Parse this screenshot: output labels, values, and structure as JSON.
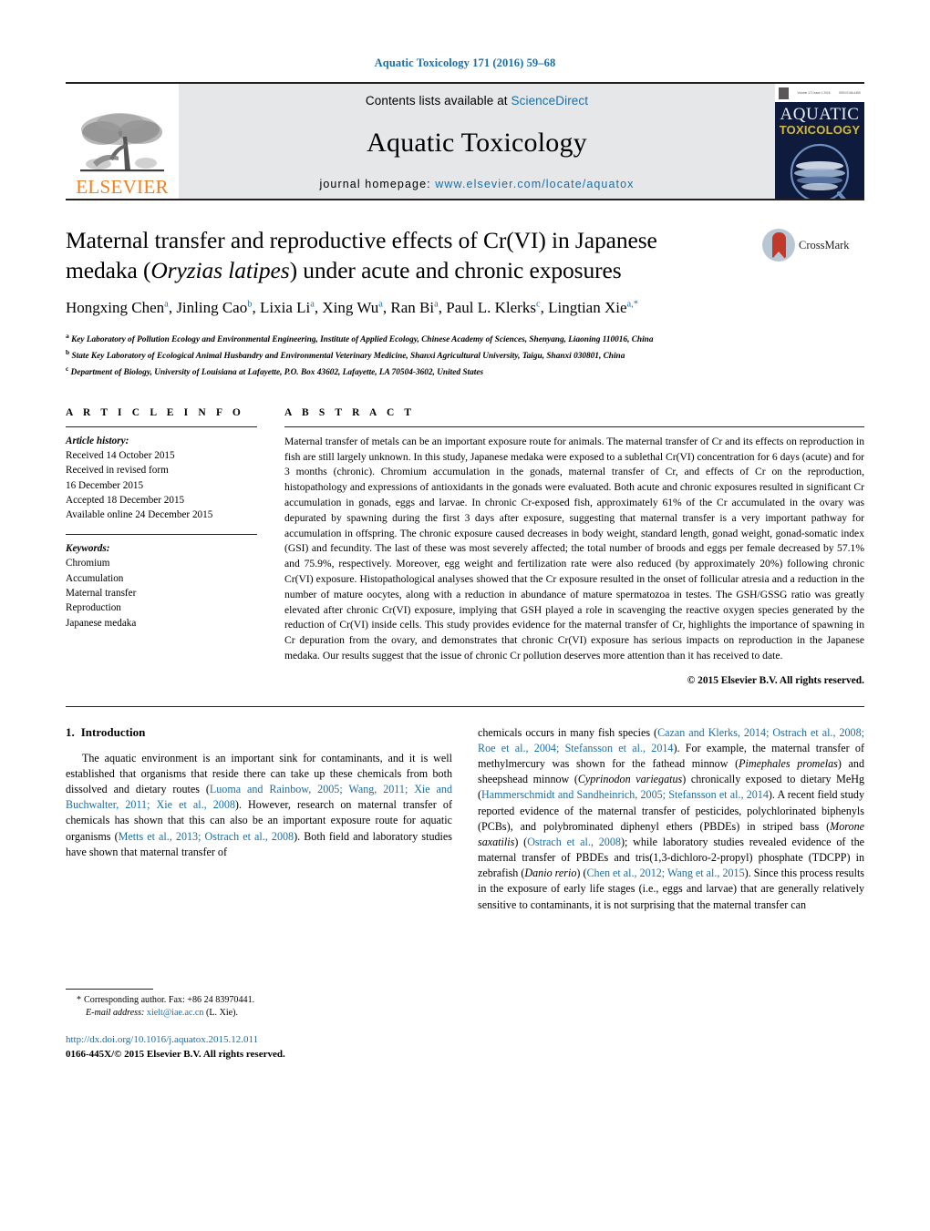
{
  "running_head": "Aquatic Toxicology 171 (2016) 59–68",
  "masthead": {
    "publisher_name": "ELSEVIER",
    "contents_prefix": "Contents lists available at ",
    "contents_link": "ScienceDirect",
    "journal_title": "Aquatic Toxicology",
    "homepage_prefix": "journal homepage: ",
    "homepage_url": "www.elsevier.com/locate/aquatox",
    "cover": {
      "line1": "AQUATIC",
      "line2": "TOXICOLOGY",
      "masthead_tiny_left": "Volume 171 Issue 1 2016",
      "masthead_tiny_right": "ISSN 0166-445X"
    }
  },
  "article": {
    "title_line1": "Maternal transfer and reproductive effects of Cr(VI) in Japanese",
    "title_line2_pre": "medaka (",
    "title_line2_italic": "Oryzias latipes",
    "title_line2_post": ") under acute and chronic exposures",
    "crossmark_label": "CrossMark",
    "authors": [
      {
        "name": "Hongxing Chen",
        "sup": "a",
        "sep": ", "
      },
      {
        "name": "Jinling Cao",
        "sup": "b",
        "sep": ", "
      },
      {
        "name": "Lixia Li",
        "sup": "a",
        "sep": ", "
      },
      {
        "name": "Xing Wu",
        "sup": "a",
        "sep": ", "
      },
      {
        "name": "Ran Bi",
        "sup": "a",
        "sep": ", "
      },
      {
        "name": "Paul L. Klerks",
        "sup": "c",
        "sep": ", "
      },
      {
        "name": "Lingtian Xie",
        "sup": "a,*",
        "sep": ""
      }
    ],
    "affiliations": [
      {
        "marker": "a",
        "text": "Key Laboratory of Pollution Ecology and Environmental Engineering, Institute of Applied Ecology, Chinese Academy of Sciences, Shenyang, Liaoning 110016, China"
      },
      {
        "marker": "b",
        "text": "State Key Laboratory of Ecological Animal Husbandry and Environmental Veterinary Medicine, Shanxi Agricultural University, Taigu, Shanxi 030801, China"
      },
      {
        "marker": "c",
        "text": "Department of Biology, University of Louisiana at Lafayette, P.O. Box 43602, Lafayette, LA 70504-3602, United States"
      }
    ]
  },
  "article_info": {
    "heading": "A R T I C L E   I N F O",
    "history_label": "Article history:",
    "history": [
      "Received 14 October 2015",
      "Received in revised form",
      "16 December 2015",
      "Accepted 18 December 2015",
      "Available online 24 December 2015"
    ],
    "keywords_label": "Keywords:",
    "keywords": [
      "Chromium",
      "Accumulation",
      "Maternal transfer",
      "Reproduction",
      "Japanese medaka"
    ]
  },
  "abstract": {
    "heading": "A B S T R A C T",
    "text": "Maternal transfer of metals can be an important exposure route for animals. The maternal transfer of Cr and its effects on reproduction in fish are still largely unknown. In this study, Japanese medaka were exposed to a sublethal Cr(VI) concentration for 6 days (acute) and for 3 months (chronic). Chromium accumulation in the gonads, maternal transfer of Cr, and effects of Cr on the reproduction, histopathology and expressions of antioxidants in the gonads were evaluated. Both acute and chronic exposures resulted in significant Cr accumulation in gonads, eggs and larvae. In chronic Cr-exposed fish, approximately 61% of the Cr accumulated in the ovary was depurated by spawning during the first 3 days after exposure, suggesting that maternal transfer is a very important pathway for accumulation in offspring. The chronic exposure caused decreases in body weight, standard length, gonad weight, gonad-somatic index (GSI) and fecundity. The last of these was most severely affected; the total number of broods and eggs per female decreased by 57.1% and 75.9%, respectively. Moreover, egg weight and fertilization rate were also reduced (by approximately 20%) following chronic Cr(VI) exposure. Histopathological analyses showed that the Cr exposure resulted in the onset of follicular atresia and a reduction in the number of mature oocytes, along with a reduction in abundance of mature spermatozoa in testes. The GSH/GSSG ratio was greatly elevated after chronic Cr(VI) exposure, implying that GSH played a role in scavenging the reactive oxygen species generated by the reduction of Cr(VI) inside cells. This study provides evidence for the maternal transfer of Cr, highlights the importance of spawning in Cr depuration from the ovary, and demonstrates that chronic Cr(VI) exposure has serious impacts on reproduction in the Japanese medaka. Our results suggest that the issue of chronic Cr pollution deserves more attention than it has received to date.",
    "copyright": "© 2015 Elsevier B.V. All rights reserved."
  },
  "introduction": {
    "number": "1.",
    "heading": "Introduction",
    "left_para_1": "The aquatic environment is an important sink for contaminants, and it is well established that organisms that reside there can take up these chemicals from both dissolved and dietary routes (",
    "left_ref_1": "Luoma and Rainbow, 2005; Wang, 2011; Xie and Buchwalter, 2011; Xie et al., 2008",
    "left_para_2": "). However, research on maternal transfer of chemicals has shown that this can also be an important exposure route for aquatic organisms (",
    "left_ref_2": "Metts et al., 2013; Ostrach et al., 2008",
    "left_para_3": "). Both field and laboratory studies have shown that maternal transfer of",
    "right_para_1": "chemicals occurs in many fish species (",
    "right_ref_1": "Cazan and Klerks, 2014; Ostrach et al., 2008; Roe et al., 2004; Stefansson et al., 2014",
    "right_para_2": "). For example, the maternal transfer of methylmercury was shown for the fathead minnow (",
    "right_italic_1": "Pimephales promelas",
    "right_para_3": ") and sheepshead minnow (",
    "right_italic_2": "Cyprinodon variegatus",
    "right_para_4": ") chronically exposed to dietary MeHg (",
    "right_ref_2": "Hammerschmidt and Sandheinrich, 2005; Stefansson et al., 2014",
    "right_para_5": "). A recent field study reported evidence of the maternal transfer of pesticides, polychlorinated biphenyls (PCBs), and polybrominated diphenyl ethers (PBDEs) in striped bass (",
    "right_italic_3": "Morone saxatilis",
    "right_para_6": ") (",
    "right_ref_3": "Ostrach et al., 2008",
    "right_para_7": "); while laboratory studies revealed evidence of the maternal transfer of PBDEs and tris(1,3-dichloro-2-propyl) phosphate (TDCPP) in zebrafish (",
    "right_italic_4": "Danio rerio",
    "right_para_8": ") (",
    "right_ref_4": "Chen et al., 2012; Wang et al., 2015",
    "right_para_9": "). Since this process results in the exposure of early life stages (i.e., eggs and larvae) that are generally relatively sensitive to contaminants, it is not surprising that the maternal transfer can"
  },
  "footnote": {
    "star": "*",
    "corresponding": "Corresponding author. Fax: +86 24 83970441.",
    "email_label": "E-mail address:",
    "email": "xielt@iae.ac.cn",
    "email_suffix": "(L. Xie)."
  },
  "doi": {
    "url": "http://dx.doi.org/10.1016/j.aquatox.2015.12.011",
    "issn_line": "0166-445X/© 2015 Elsevier B.V. All rights reserved."
  },
  "colors": {
    "link_blue": "#1a6ea8",
    "elsevier_orange": "#f08121",
    "cover_navy": "#0f1b3c",
    "cover_gold": "#d6b93c",
    "masthead_gray": "#e6e7e8"
  }
}
